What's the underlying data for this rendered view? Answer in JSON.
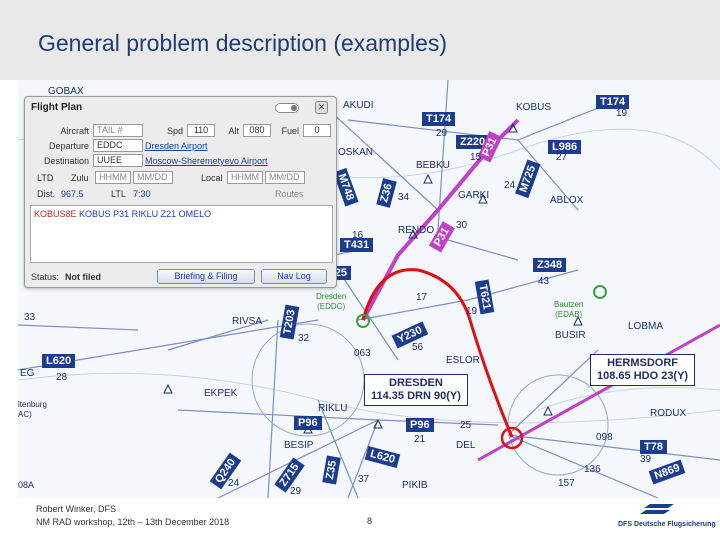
{
  "slide": {
    "title": "General problem description (examples)"
  },
  "flight_plan": {
    "title": "Flight Plan",
    "aircraft_label": "Aircraft",
    "aircraft_value": "TAIL #",
    "spd_label": "Spd",
    "spd_value": "110",
    "alt_label": "Alt",
    "alt_value": "080",
    "fuel_label": "Fuel",
    "fuel_value": "0",
    "departure_label": "Departure",
    "departure_code": "EDDC",
    "departure_name": "Dresden Airport",
    "destination_label": "Destination",
    "destination_code": "UUEE",
    "destination_name": "Moscow-Sheremetyevo Airport",
    "ltd_label": "LTD",
    "zulu_label": "Zulu",
    "zulu_time": "HHMM",
    "zulu_date": "MM/DD",
    "local_label": "Local",
    "local_time": "HHMM",
    "local_date": "MM/DD",
    "dist_label": "Dist.",
    "dist_value": "967.5",
    "lte_label": "LTL",
    "lte_value": "7:30",
    "routes_label": "Routes",
    "route_part1": "KOBUS8E",
    "route_part2": "KOBUS P31 RIKLU Z21 OMELO",
    "status_label": "Status:",
    "status_value": "Not filed",
    "briefing_button": "Briefing & Filing",
    "navlog_button": "Nav Log",
    "close_glyph": "✕"
  },
  "map": {
    "airways": [
      "T174",
      "T174",
      "Z220",
      "L986",
      "M725",
      "P31",
      "Z36",
      "M748",
      "T431",
      "Z348",
      "T621",
      "P31",
      "Y230",
      "T203",
      "L620",
      "P96",
      "P96",
      "L620",
      "Z35",
      "Z715",
      "Q240",
      "T78",
      "N869",
      "Z25"
    ],
    "waypoints": [
      "AKUDI",
      "KOBUS",
      "BEBKU",
      "GARKI",
      "ABLOX",
      "RENDO",
      "OSKAN",
      "RIVSA",
      "LOBMA",
      "BUSIR",
      "ESLOR",
      "EKPEK",
      "RIKLU",
      "RODUX",
      "BESIP",
      "PIKIB",
      "DEL",
      "EG",
      "GOBAX"
    ],
    "airports": [
      {
        "name": "Dresden",
        "code": "(EDDC)"
      },
      {
        "name": "Bautzen",
        "code": "(EDAB)"
      }
    ],
    "navaids": [
      {
        "name": "DRESDEN",
        "freq": "114.35 DRN 90(Y)"
      },
      {
        "name": "HERMSDORF",
        "freq": "108.65 HDO 23(Y)"
      }
    ],
    "side_labels": [
      "ltenburg",
      "AC)",
      "08A"
    ],
    "numbers": [
      "29",
      "19",
      "15",
      "27",
      "24",
      "34",
      "30",
      "16",
      "43",
      "17",
      "19",
      "32",
      "56",
      "28",
      "21",
      "25",
      "39",
      "136",
      "098",
      "157",
      "24",
      "29",
      "37",
      "063",
      "33"
    ]
  },
  "footer": {
    "author_line": "Robert Winker, DFS",
    "event_line": "NM RAD workshop, 12th – 13th December 2018",
    "page_number": "8",
    "logo_text": "DFS Deutsche Flugsicherung"
  },
  "colors": {
    "title": "#1f3c74",
    "airway_blue": "#1c3c8e",
    "route_pink": "#c040c8",
    "route_red": "#e01010",
    "airport_green": "#3aa040"
  }
}
